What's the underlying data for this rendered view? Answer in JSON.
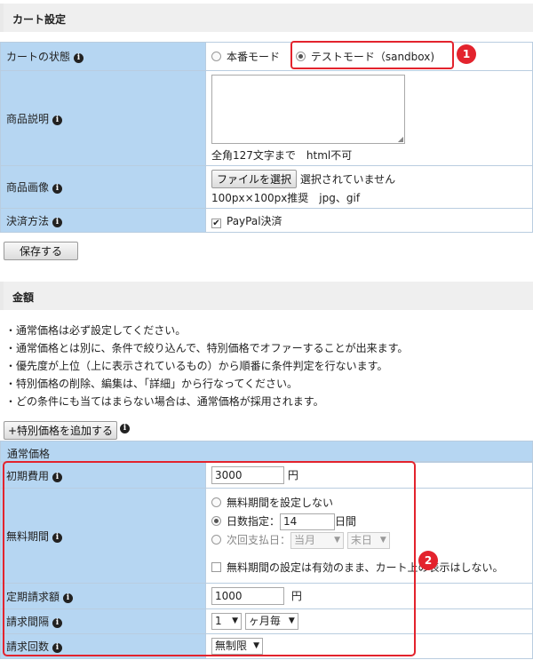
{
  "cart": {
    "title": "カート設定",
    "rows": {
      "status_label": "カートの状態",
      "mode_production": "本番モード",
      "mode_test": "テストモード（sandbox)",
      "desc_label": "商品説明",
      "desc_hint": "全角127文字まで　html不可",
      "image_label": "商品画像",
      "file_button": "ファイルを選択",
      "file_status": "選択されていません",
      "image_hint": "100px×100px推奨　jpg、gif",
      "payment_label": "決済方法",
      "payment_paypal": "PayPal決済"
    },
    "save_button": "保存する"
  },
  "price": {
    "title": "金額",
    "notes": [
      "通常価格は必ず設定してください。",
      "通常価格とは別に、条件で絞り込んで、特別価格でオファーすることが出来ます。",
      "優先度が上位（上に表示されているもの）から順番に条件判定を行ないます。",
      "特別価格の削除、編集は、「詳細」から行なってください。",
      "どの条件にも当てはまらない場合は、通常価格が採用されます。"
    ],
    "add_special_button": "+特別価格を追加する",
    "normal_price_head": "通常価格",
    "initial_label": "初期費用",
    "initial_value": "3000",
    "yen": "円",
    "free_label": "無料期間",
    "free_none": "無料期間を設定しない",
    "free_days_label": "日数指定：",
    "free_days_value": "14",
    "free_days_unit": "日間",
    "free_next_label": "次回支払日：",
    "free_next_month": "当月",
    "free_next_day": "末日",
    "free_display_note": "無料期間の設定は有効のまま、カート上の表示はしない。",
    "recurring_label": "定期請求額",
    "recurring_value": "1000",
    "interval_label": "請求間隔",
    "interval_value": "1",
    "interval_unit": "ヶ月毎",
    "count_label": "請求回数",
    "count_value": "無制限"
  },
  "annotations": {
    "badge1": "1",
    "badge2": "2"
  },
  "colors": {
    "label_bg": "#b6d6f2",
    "highlight": "#e3232d"
  }
}
